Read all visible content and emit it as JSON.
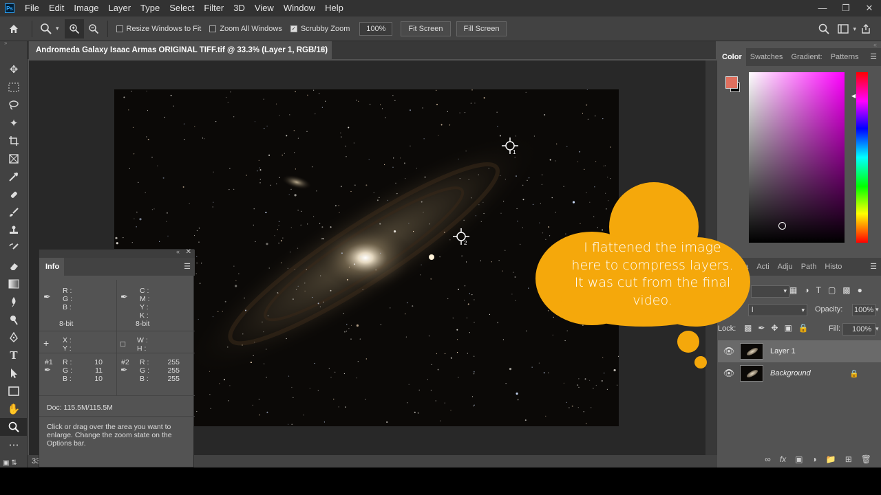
{
  "menubar": {
    "logo": "Ps",
    "items": [
      "File",
      "Edit",
      "Image",
      "Layer",
      "Type",
      "Select",
      "Filter",
      "3D",
      "View",
      "Window",
      "Help"
    ]
  },
  "options": {
    "resize_windows": "Resize Windows to Fit",
    "zoom_all_windows": "Zoom All Windows",
    "scrubby_zoom": "Scrubby Zoom",
    "zoom_value": "100%",
    "fit_screen": "Fit Screen",
    "fill_screen": "Fill Screen"
  },
  "document": {
    "tab_title": "Andromeda Galaxy Isaac Armas ORIGINAL TIFF.tif @ 33.3% (Layer 1, RGB/16) *",
    "zoom_readout": "33"
  },
  "color_panel": {
    "tabs": [
      "Color",
      "Swatches",
      "Gradient:",
      "Patterns"
    ],
    "foreground": "#e0705f",
    "background": "#000000"
  },
  "layers_panel": {
    "tabs": [
      "s",
      "Cha",
      "Acti",
      "Adju",
      "Path",
      "Histo"
    ],
    "opacity_label": "Opacity:",
    "opacity_value": "100%",
    "lock_label": "Lock:",
    "fill_label": "Fill:",
    "fill_value": "100%",
    "blend_mode": "l",
    "layers": [
      {
        "name": "Layer 1"
      },
      {
        "name": "Background"
      }
    ]
  },
  "info_panel": {
    "tab": "Info",
    "rgb_labels": [
      "R :",
      "G :",
      "B :"
    ],
    "cmyk_labels": [
      "C :",
      "M :",
      "Y :",
      "K :"
    ],
    "bit_depth_left": "8-bit",
    "bit_depth_right": "8-bit",
    "xy_labels": [
      "X :",
      "Y :"
    ],
    "wh_labels": [
      "W :",
      "H :"
    ],
    "sampler1": {
      "label": "#1",
      "R": "10",
      "G": "11",
      "B": "10"
    },
    "sampler2": {
      "label": "#2",
      "R": "255",
      "G": "255",
      "B": "255"
    },
    "doc_size": "Doc: 115.5M/115.5M",
    "hint": "Click or drag over the area you want to enlarge. Change the zoom state on the Options bar."
  },
  "callout": {
    "text": "I flattened the image here to compress layers. It was cut from the final video.",
    "color": "#f5a80b"
  },
  "samplers_on_canvas": [
    "1",
    "2"
  ]
}
